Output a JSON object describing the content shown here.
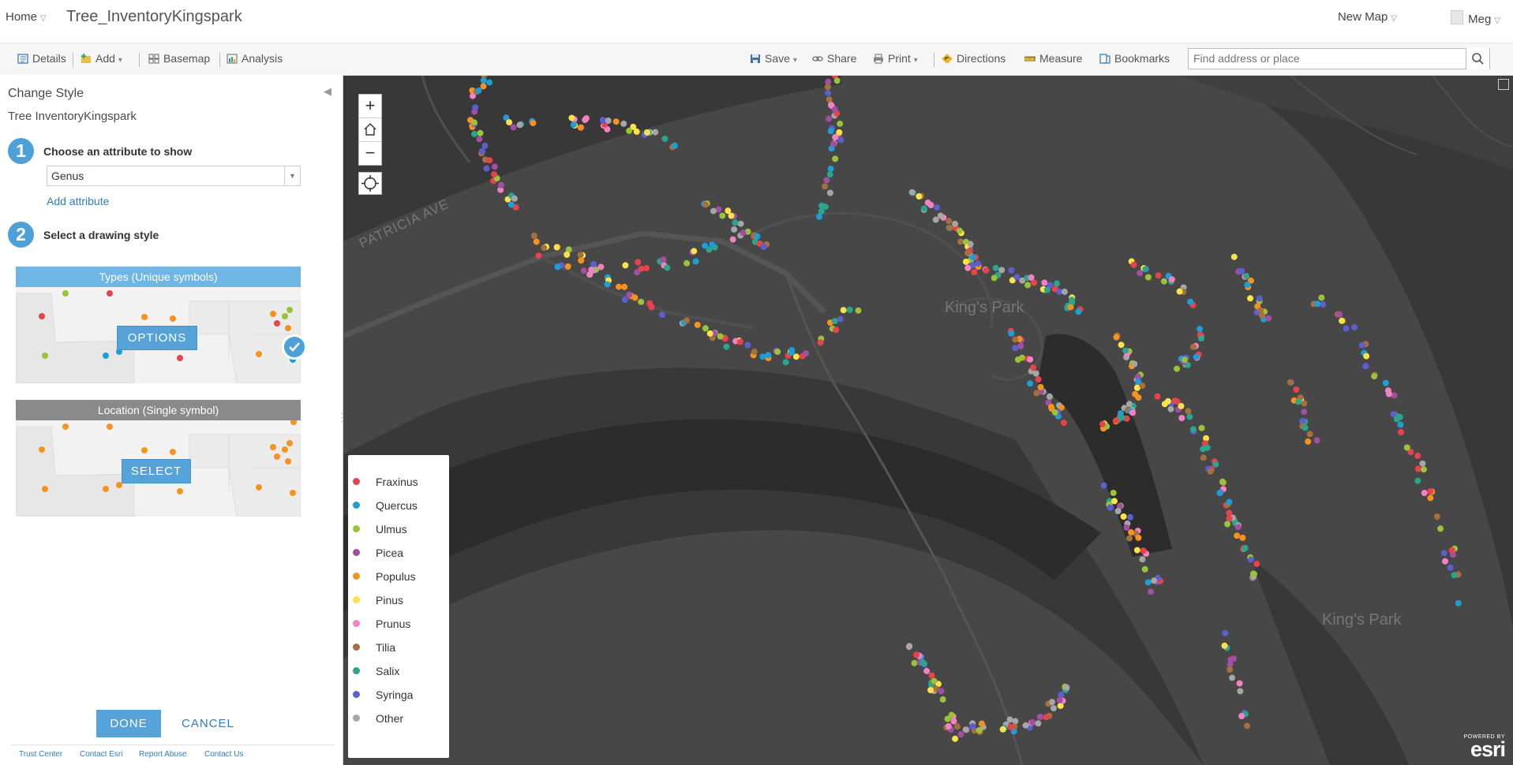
{
  "topbar": {
    "home_label": "Home",
    "map_title": "Tree_InventoryKingspark",
    "new_map_label": "New Map",
    "user_name": "Meg"
  },
  "toolbar": {
    "details": "Details",
    "add": "Add",
    "basemap": "Basemap",
    "analysis": "Analysis",
    "save": "Save",
    "share": "Share",
    "print": "Print",
    "directions": "Directions",
    "measure": "Measure",
    "bookmarks": "Bookmarks",
    "search_placeholder": "Find address or place"
  },
  "panel": {
    "title": "Change Style",
    "layer_name": "Tree InventoryKingspark",
    "step1": {
      "number": "1",
      "label": "Choose an attribute to show",
      "selected_attribute": "Genus",
      "add_attribute": "Add attribute"
    },
    "step2": {
      "number": "2",
      "label": "Select a drawing style"
    },
    "styles": [
      {
        "header": "Types (Unique symbols)",
        "button": "OPTIONS",
        "selected": true
      },
      {
        "header": "Location (Single symbol)",
        "button": "SELECT",
        "selected": false
      }
    ],
    "done": "DONE",
    "cancel": "CANCEL",
    "footer_links": [
      "Trust Center",
      "Contact Esri",
      "Report Abuse",
      "Contact Us"
    ]
  },
  "map": {
    "street_label": "PATRICIA AVE",
    "park_labels": [
      "King's Park",
      "King's Park"
    ],
    "attribution_small": "POWERED BY",
    "attribution_logo": "esri",
    "zoom_in": "+",
    "zoom_out": "−"
  },
  "legend": [
    {
      "label": "Fraxinus",
      "color": "#e8434d"
    },
    {
      "label": "Quercus",
      "color": "#1d9ed6"
    },
    {
      "label": "Ulmus",
      "color": "#9bc33a"
    },
    {
      "label": "Picea",
      "color": "#a24ea3"
    },
    {
      "label": "Populus",
      "color": "#f69220"
    },
    {
      "label": "Pinus",
      "color": "#fde24a"
    },
    {
      "label": "Prunus",
      "color": "#f282c4"
    },
    {
      "label": "Tilia",
      "color": "#a3703e"
    },
    {
      "label": "Salix",
      "color": "#2ba58c"
    },
    {
      "label": "Syringa",
      "color": "#5d5fcf"
    },
    {
      "label": "Other",
      "color": "#a6a6a6"
    }
  ]
}
